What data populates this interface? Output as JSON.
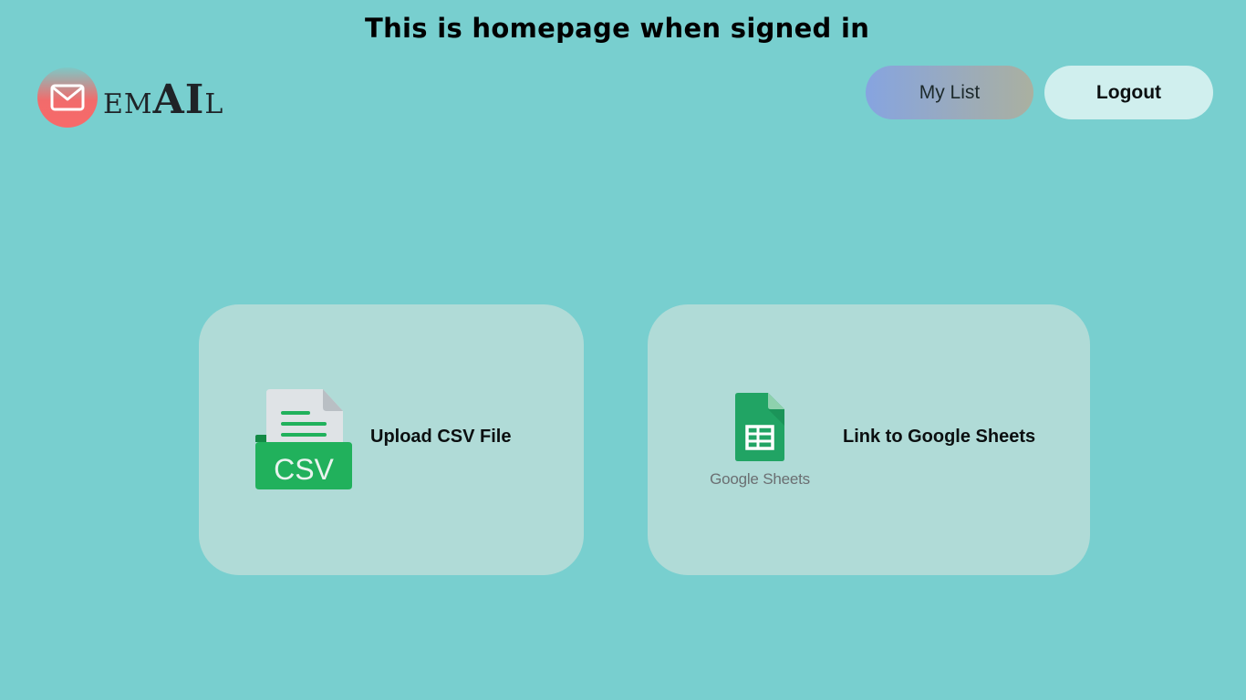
{
  "caption": "This is homepage when signed in",
  "brand": {
    "prefix": "EM",
    "highlight": "AI",
    "suffix": "L",
    "icon": "mail-icon",
    "badge_gradient": [
      "#7ec8c6",
      "#f76a6a"
    ]
  },
  "header": {
    "my_list_label": "My List",
    "logout_label": "Logout"
  },
  "options": {
    "csv": {
      "icon": "csv-file-icon",
      "icon_text": "CSV",
      "label": "Upload CSV File"
    },
    "sheets": {
      "icon": "google-sheets-icon",
      "wordmark": "Google Sheets",
      "label": "Link to Google Sheets"
    }
  },
  "colors": {
    "background": "#78cfcf",
    "card": "#b0dbd7",
    "logout_button": "#d0efee",
    "csv_green": "#21b15c",
    "sheets_green": "#21a464"
  }
}
